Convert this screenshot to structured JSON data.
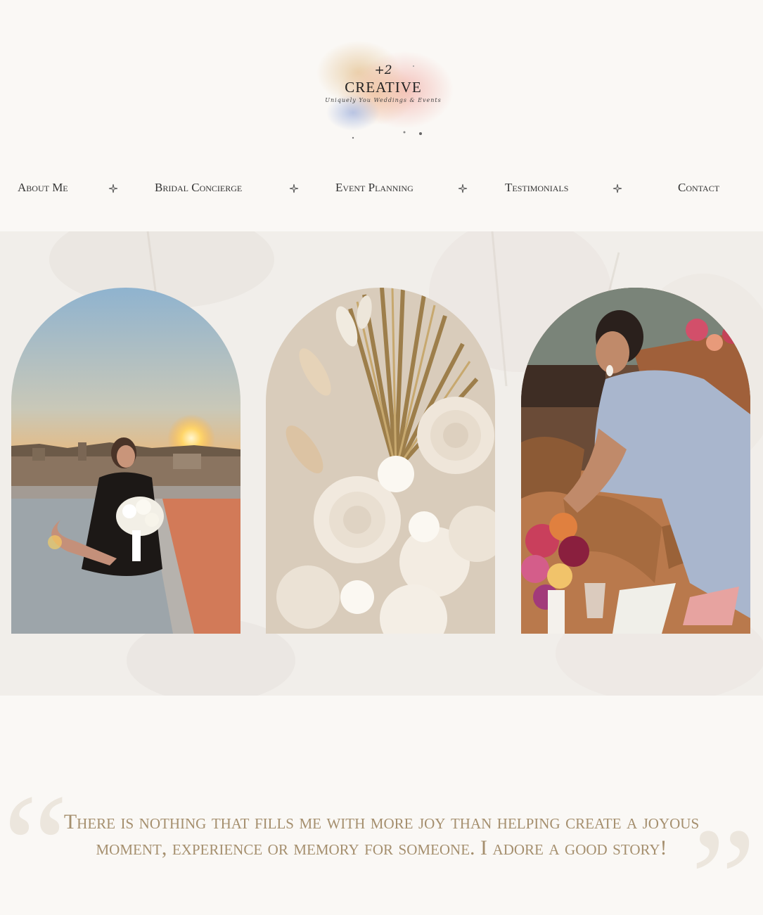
{
  "logo": {
    "mark": "+2",
    "title": "CREATIVE",
    "tagline": "Uniquely You Weddings & Events"
  },
  "nav": {
    "items": [
      "About Me",
      "Bridal Concierge",
      "Event Planning",
      "Testimonials",
      "Contact"
    ],
    "separator_icon": "four-point-star-icon"
  },
  "gallery": {
    "photos": [
      {
        "name": "bride-sunset-rooftop-photo"
      },
      {
        "name": "dried-flowers-bouquet-photo"
      },
      {
        "name": "planner-setting-table-photo"
      }
    ]
  },
  "quote": {
    "text": "There is nothing that fills me with more joy than helping create a joyous moment, experience or memory for someone. I adore a good story!",
    "open_mark": "“",
    "close_mark": "”"
  },
  "colors": {
    "background": "#faf8f5",
    "hero_band": "#f1eeea",
    "quote_text": "#a58f6e",
    "quote_marks": "#ece6dd"
  }
}
